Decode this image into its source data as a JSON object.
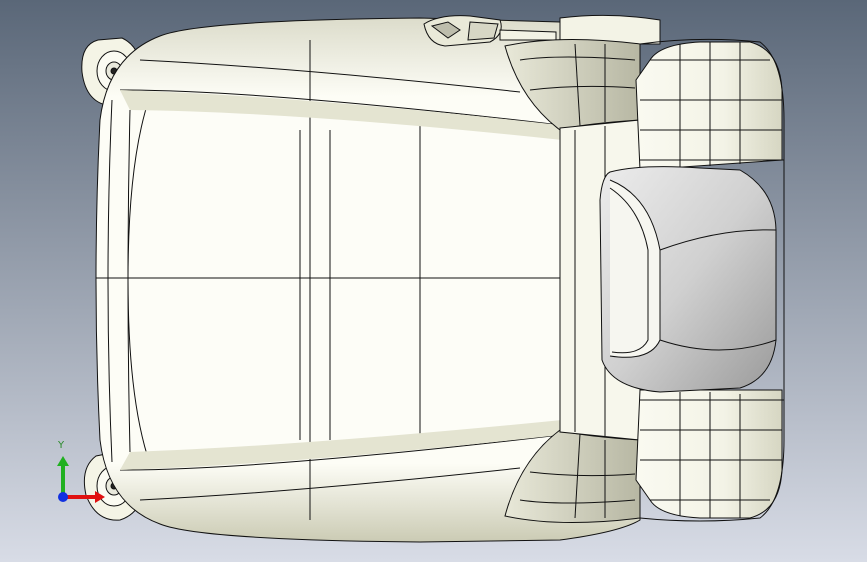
{
  "viewport": {
    "background_top": "#5a6778",
    "background_bottom": "#d8dce6",
    "model_fill": "#fbfbf3",
    "model_shadow": "#cfcfba",
    "headrest_shade": "#c9c9c9",
    "edge_color": "#111111"
  },
  "triad": {
    "y_axis_label": "Y",
    "x_axis_color": "#e01010",
    "y_axis_color": "#20b020",
    "z_axis_color": "#1030e0"
  }
}
